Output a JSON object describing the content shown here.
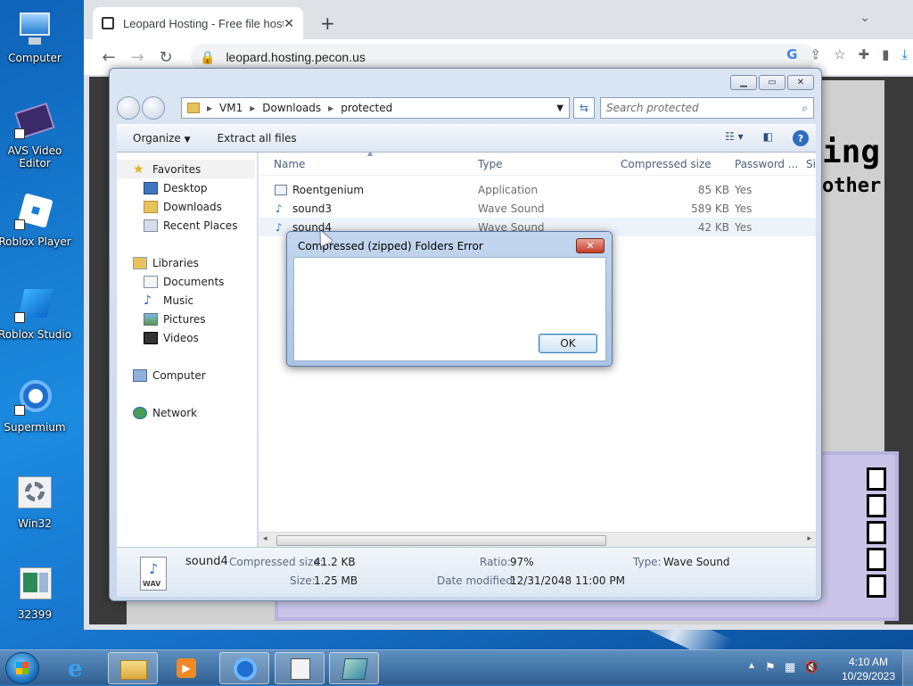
{
  "desktop": {
    "icons": [
      {
        "label": "Computer"
      },
      {
        "label": "AVS Video Editor"
      },
      {
        "label": "Roblox Player"
      },
      {
        "label": "Roblox Studio"
      },
      {
        "label": "Supermium"
      },
      {
        "label": "Win32"
      },
      {
        "label": "32399"
      }
    ]
  },
  "browser": {
    "tab_title": "Leopard Hosting - Free file host",
    "url": "leopard.hosting.pecon.us",
    "page_text_1": "ing",
    "page_text_2": "other"
  },
  "explorer": {
    "breadcrumb": [
      "VM1",
      "Downloads",
      "protected"
    ],
    "search_placeholder": "Search protected",
    "toolbar": {
      "organize": "Organize",
      "extract": "Extract all files"
    },
    "nav": {
      "favorites": "Favorites",
      "favorites_items": [
        "Desktop",
        "Downloads",
        "Recent Places"
      ],
      "libraries": "Libraries",
      "libraries_items": [
        "Documents",
        "Music",
        "Pictures",
        "Videos"
      ],
      "computer": "Computer",
      "network": "Network"
    },
    "columns": [
      "Name",
      "Type",
      "Compressed size",
      "Password ...",
      "Si"
    ],
    "files": [
      {
        "name": "Roentgenium",
        "type": "Application",
        "size": "85 KB",
        "password": "Yes"
      },
      {
        "name": "sound3",
        "type": "Wave Sound",
        "size": "589 KB",
        "password": "Yes"
      },
      {
        "name": "sound4",
        "type": "Wave Sound",
        "size": "42 KB",
        "password": "Yes"
      }
    ],
    "details": {
      "name": "sound4",
      "compressed_label": "Compressed size:",
      "compressed_value": "41.2 KB",
      "size_label": "Size:",
      "size_value": "1.25 MB",
      "ratio_label": "Ratio:",
      "ratio_value": "97%",
      "modified_label": "Date modified:",
      "modified_value": "12/31/2048 11:00 PM",
      "type_label": "Type:",
      "type_value": "Wave Sound",
      "thumb_label": "WAV"
    }
  },
  "dialog": {
    "title": "Compressed (zipped) Folders Error",
    "ok": "OK"
  },
  "taskbar": {
    "time": "4:10 AM",
    "date": "10/29/2023"
  }
}
